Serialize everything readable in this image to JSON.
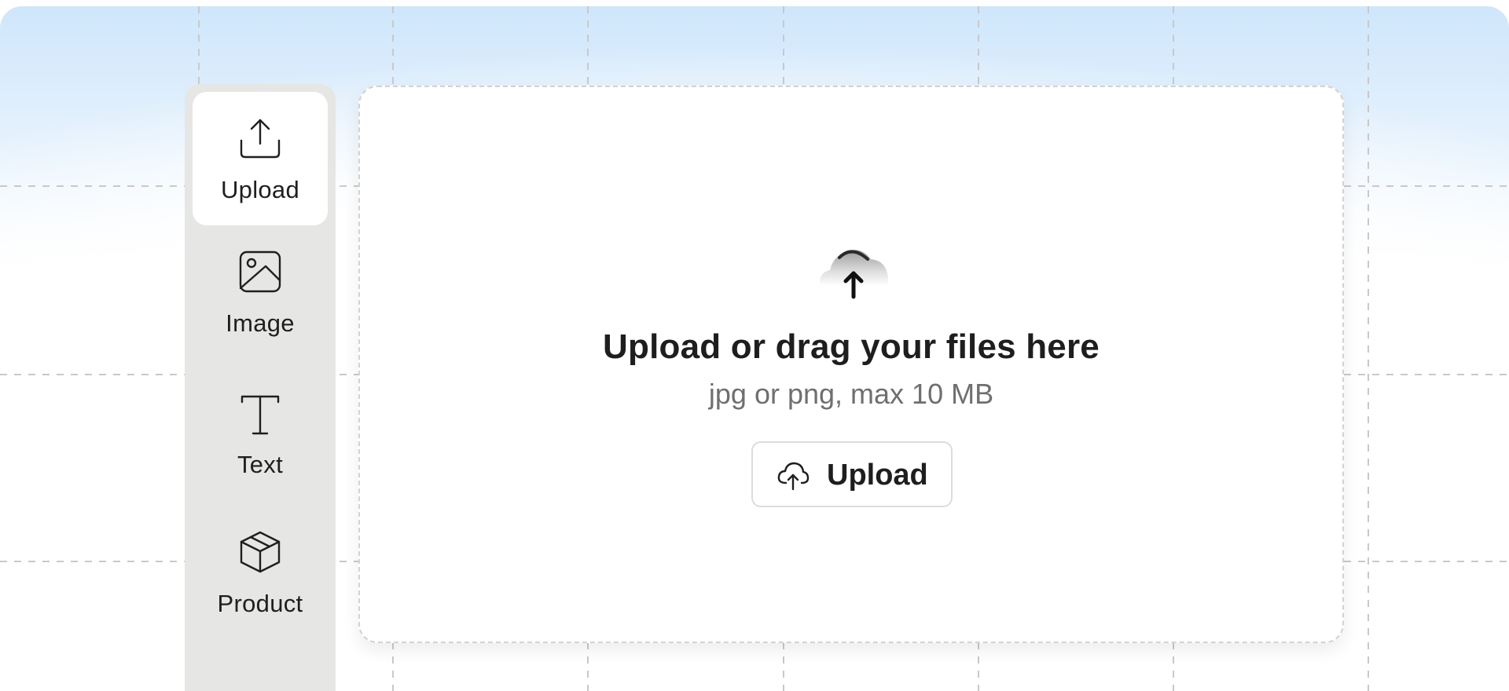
{
  "sidebar": {
    "items": [
      {
        "label": "Upload",
        "icon": "upload-icon",
        "active": true
      },
      {
        "label": "Image",
        "icon": "image-icon",
        "active": false
      },
      {
        "label": "Text",
        "icon": "text-icon",
        "active": false
      },
      {
        "label": "Product",
        "icon": "box-icon",
        "active": false
      }
    ]
  },
  "dropzone": {
    "icon": "cloud-upload-icon",
    "title": "Upload or drag your files here",
    "subtitle": "jpg or png, max 10 MB",
    "button": {
      "label": "Upload",
      "icon": "cloud-upload-icon"
    }
  },
  "colors": {
    "background_top": "#cfe6fb",
    "rail": "#e6e6e4",
    "card": "#ffffff",
    "text_primary": "#1e1e1e",
    "text_secondary": "#6f6f6f",
    "dash": "#d2d2d2"
  }
}
